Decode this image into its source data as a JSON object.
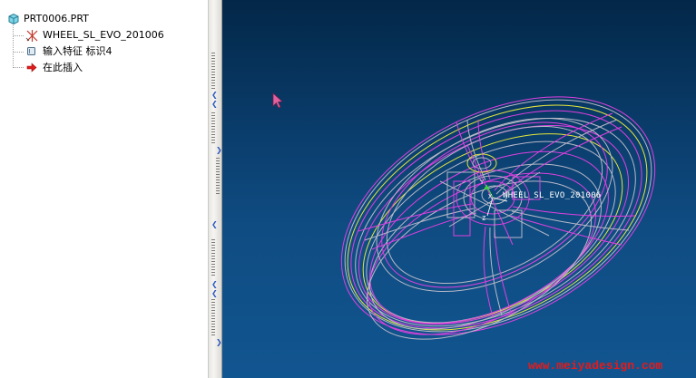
{
  "model_tree": {
    "items": [
      {
        "label": "PRT0006.PRT",
        "icon": "part-cube-icon"
      },
      {
        "label": "WHEEL_SL_EVO_201006",
        "icon": "coordinate-system-icon"
      },
      {
        "label": "输入特征 标识4",
        "icon": "import-feature-icon"
      },
      {
        "label": "在此插入",
        "icon": "insert-here-arrow-icon"
      }
    ]
  },
  "viewport": {
    "model_label": "WHEEL_SL_EVO_201006",
    "csys_axes": {
      "x": "X",
      "y": "Y",
      "z": "Z"
    },
    "watermark": "www.meiyadesign.com"
  },
  "colors": {
    "viewport_top": "#032748",
    "viewport_bottom": "#115590",
    "wire_magenta": "#e040e0",
    "wire_gray": "#b8b8c8",
    "wire_yellow": "#e6e63c",
    "watermark": "#e61a1a"
  }
}
